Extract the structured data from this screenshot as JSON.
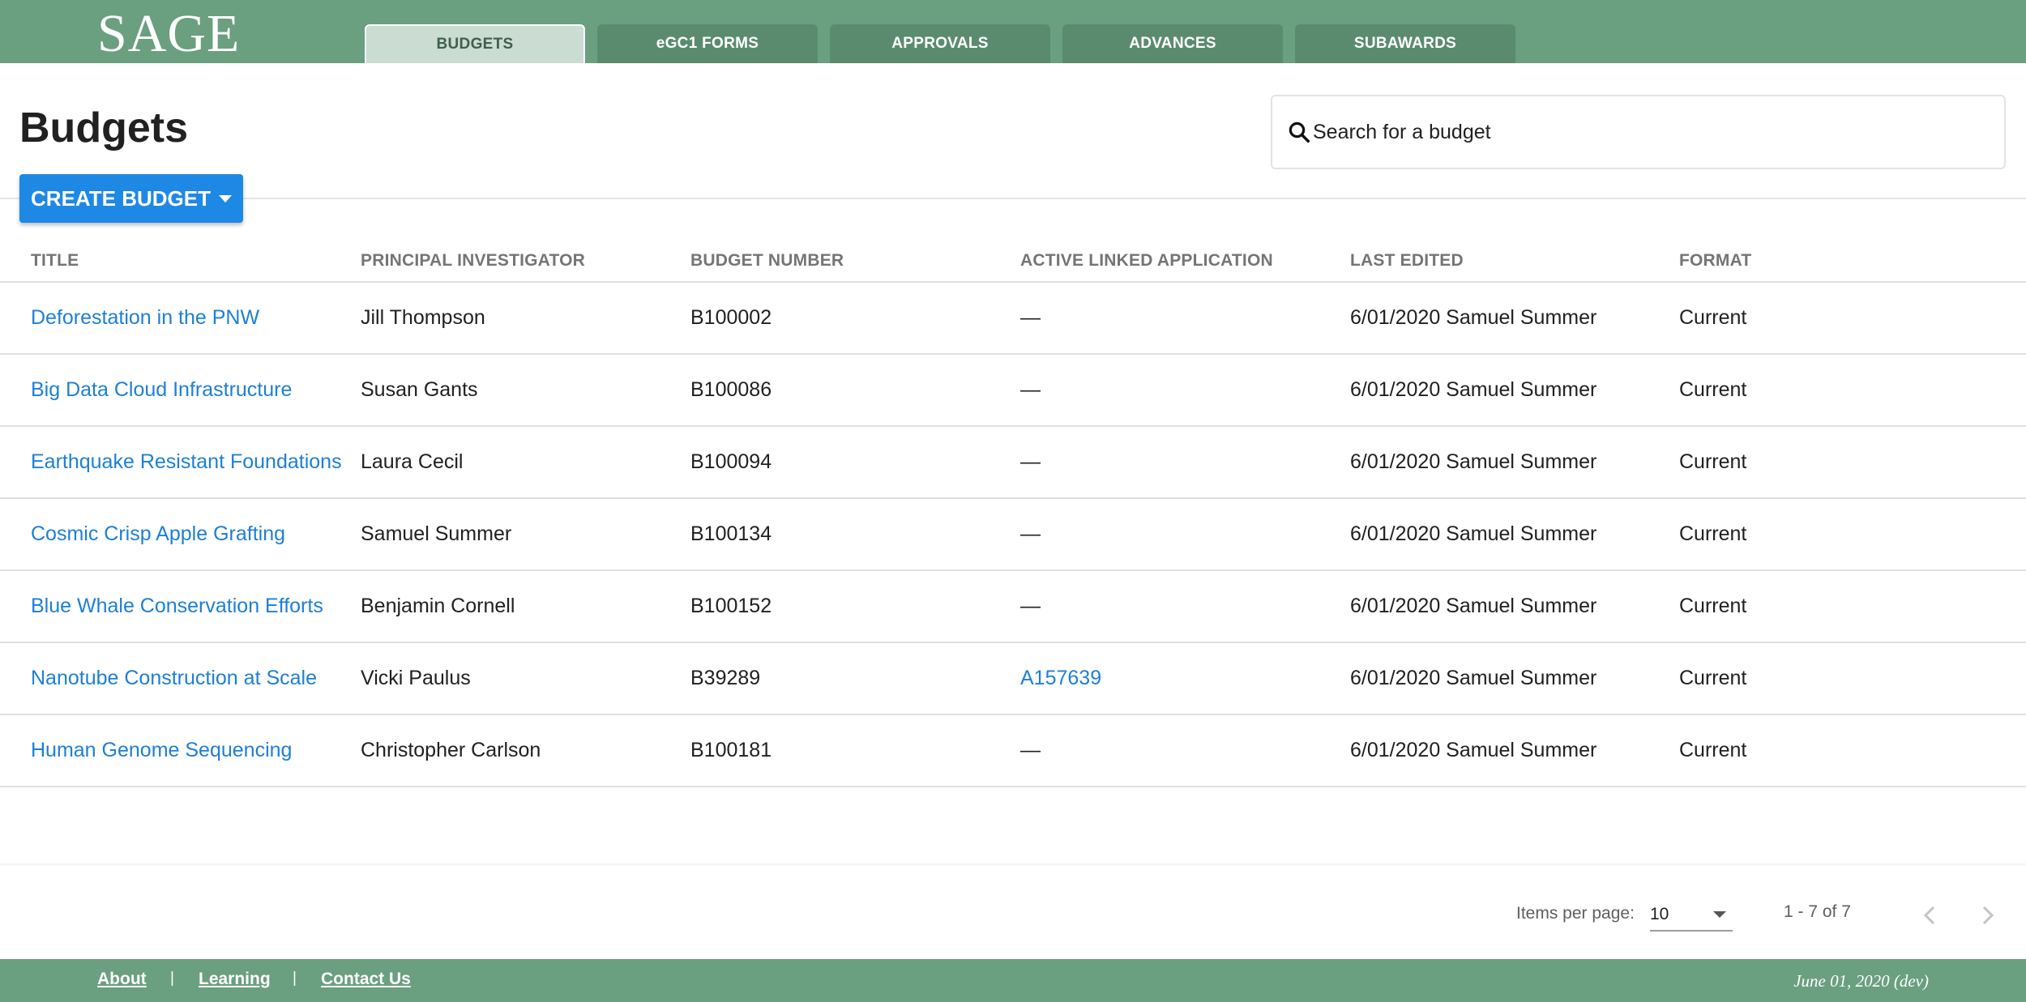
{
  "header": {
    "logo": "SAGE",
    "tabs": [
      {
        "label": "BUDGETS",
        "active": true
      },
      {
        "label": "eGC1 FORMS",
        "active": false
      },
      {
        "label": "APPROVALS",
        "active": false
      },
      {
        "label": "ADVANCES",
        "active": false
      },
      {
        "label": "SUBAWARDS",
        "active": false
      }
    ],
    "colors": {
      "bar": "#6a9f80",
      "tab": "#5b8b6f",
      "active_tab": "#cbdcd2"
    }
  },
  "main": {
    "title": "Budgets",
    "search": {
      "placeholder": "Search for a budget",
      "value": ""
    },
    "create_button": {
      "label": "CREATE BUDGET"
    }
  },
  "table": {
    "headers": [
      "TITLE",
      "PRINCIPAL INVESTIGATOR",
      "BUDGET NUMBER",
      "ACTIVE LINKED APPLICATION",
      "LAST EDITED",
      "FORMAT"
    ],
    "rows": [
      {
        "title": "Deforestation in the PNW",
        "pi": "Jill Thompson",
        "budget_number": "B100002",
        "application": "—",
        "last_edited": "6/01/2020 Samuel Summer",
        "format": "Current"
      },
      {
        "title": "Big Data Cloud Infrastructure",
        "pi": "Susan Gants",
        "budget_number": "B100086",
        "application": "—",
        "last_edited": "6/01/2020 Samuel Summer",
        "format": "Current"
      },
      {
        "title": "Earthquake Resistant Foundations",
        "pi": "Laura Cecil",
        "budget_number": "B100094",
        "application": "—",
        "last_edited": "6/01/2020 Samuel Summer",
        "format": "Current"
      },
      {
        "title": "Cosmic Crisp Apple Grafting",
        "pi": "Samuel Summer",
        "budget_number": "B100134",
        "application": "—",
        "last_edited": "6/01/2020 Samuel Summer",
        "format": "Current"
      },
      {
        "title": "Blue Whale Conservation Efforts",
        "pi": "Benjamin Cornell",
        "budget_number": "B100152",
        "application": "—",
        "last_edited": "6/01/2020 Samuel Summer",
        "format": "Current"
      },
      {
        "title": "Nanotube Construction at Scale",
        "pi": "Vicki Paulus",
        "budget_number": "B39289",
        "application": "A157639",
        "last_edited": "6/01/2020 Samuel Summer",
        "format": "Current"
      },
      {
        "title": "Human Genome Sequencing",
        "pi": "Christopher Carlson",
        "budget_number": "B100181",
        "application": "—",
        "last_edited": "6/01/2020 Samuel Summer",
        "format": "Current"
      }
    ],
    "link_color": "#1e7fd6"
  },
  "pagination": {
    "items_per_page_label": "Items per page:",
    "items_per_page": "10",
    "range": "1 - 7 of 7"
  },
  "footer": {
    "links": [
      "About",
      "Learning",
      "Contact Us"
    ],
    "separator": "|",
    "date": "June 01, 2020 (dev)"
  }
}
